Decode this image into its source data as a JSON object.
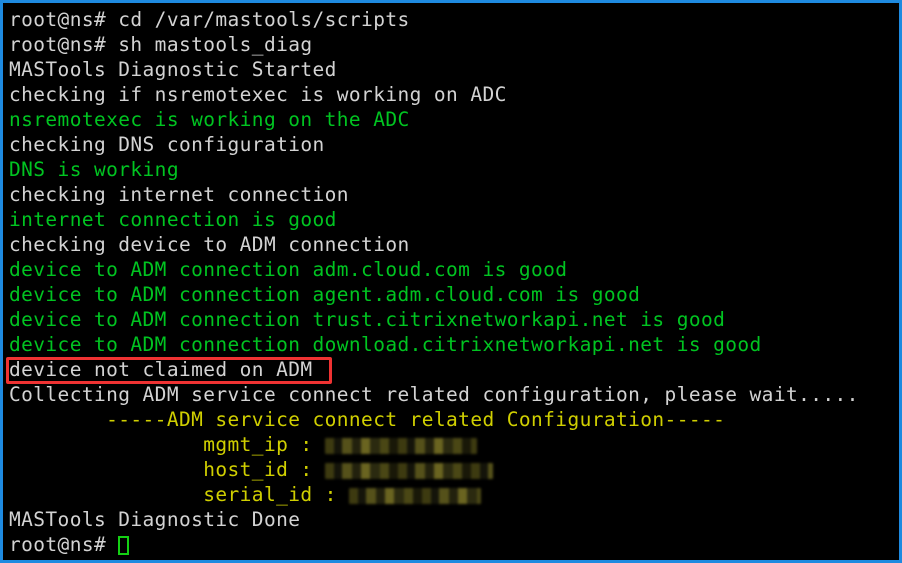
{
  "terminal": {
    "prompt": "root@ns#",
    "window_border_color": "#1e8ae0",
    "background_color": "#000000",
    "colors": {
      "normal_text": "#d3d3d3",
      "success_text": "#00c421",
      "label_text": "#d0cf00",
      "annotation": "#ef3232",
      "cursor": "#14d014"
    },
    "lines": [
      {
        "text": "root@ns# cd /var/mastools/scripts",
        "color": "gray"
      },
      {
        "text": "root@ns# sh mastools_diag",
        "color": "gray"
      },
      {
        "text": "MASTools Diagnostic Started",
        "color": "gray"
      },
      {
        "text": "checking if nsremotexec is working on ADC",
        "color": "gray"
      },
      {
        "text": "nsremotexec is working on the ADC",
        "color": "green"
      },
      {
        "text": "checking DNS configuration",
        "color": "gray"
      },
      {
        "text": "DNS is working",
        "color": "green"
      },
      {
        "text": "checking internet connection",
        "color": "gray"
      },
      {
        "text": "internet connection is good",
        "color": "green"
      },
      {
        "text": "checking device to ADM connection",
        "color": "gray"
      },
      {
        "text": "device to ADM connection adm.cloud.com is good",
        "color": "green"
      },
      {
        "text": "device to ADM connection agent.adm.cloud.com is good",
        "color": "green"
      },
      {
        "text": "device to ADM connection trust.citrixnetworkapi.net is good",
        "color": "green"
      },
      {
        "text": "device to ADM connection download.citrixnetworkapi.net is good",
        "color": "green"
      },
      {
        "text": "device not claimed on ADM",
        "color": "gray",
        "highlighted": true
      },
      {
        "text": "Collecting ADM service connect related configuration, please wait.....",
        "color": "gray"
      },
      {
        "text": "        -----ADM service connect related Configuration-----",
        "color": "yellow"
      }
    ],
    "config": {
      "heading": "-----ADM service connect related Configuration-----",
      "rows": [
        {
          "label": "mgmt_ip",
          "separator": ":",
          "value": "",
          "redacted": true
        },
        {
          "label": "host_id",
          "separator": ":",
          "value": "",
          "redacted": true
        },
        {
          "label": "serial_id",
          "separator": ":",
          "value": "",
          "redacted": true
        }
      ],
      "indent": "                "
    },
    "footer_lines": [
      {
        "text": "MASTools Diagnostic Done",
        "color": "gray"
      }
    ],
    "prompt_line": {
      "prompt": "root@ns# ",
      "cursor": "block-cursor"
    }
  }
}
